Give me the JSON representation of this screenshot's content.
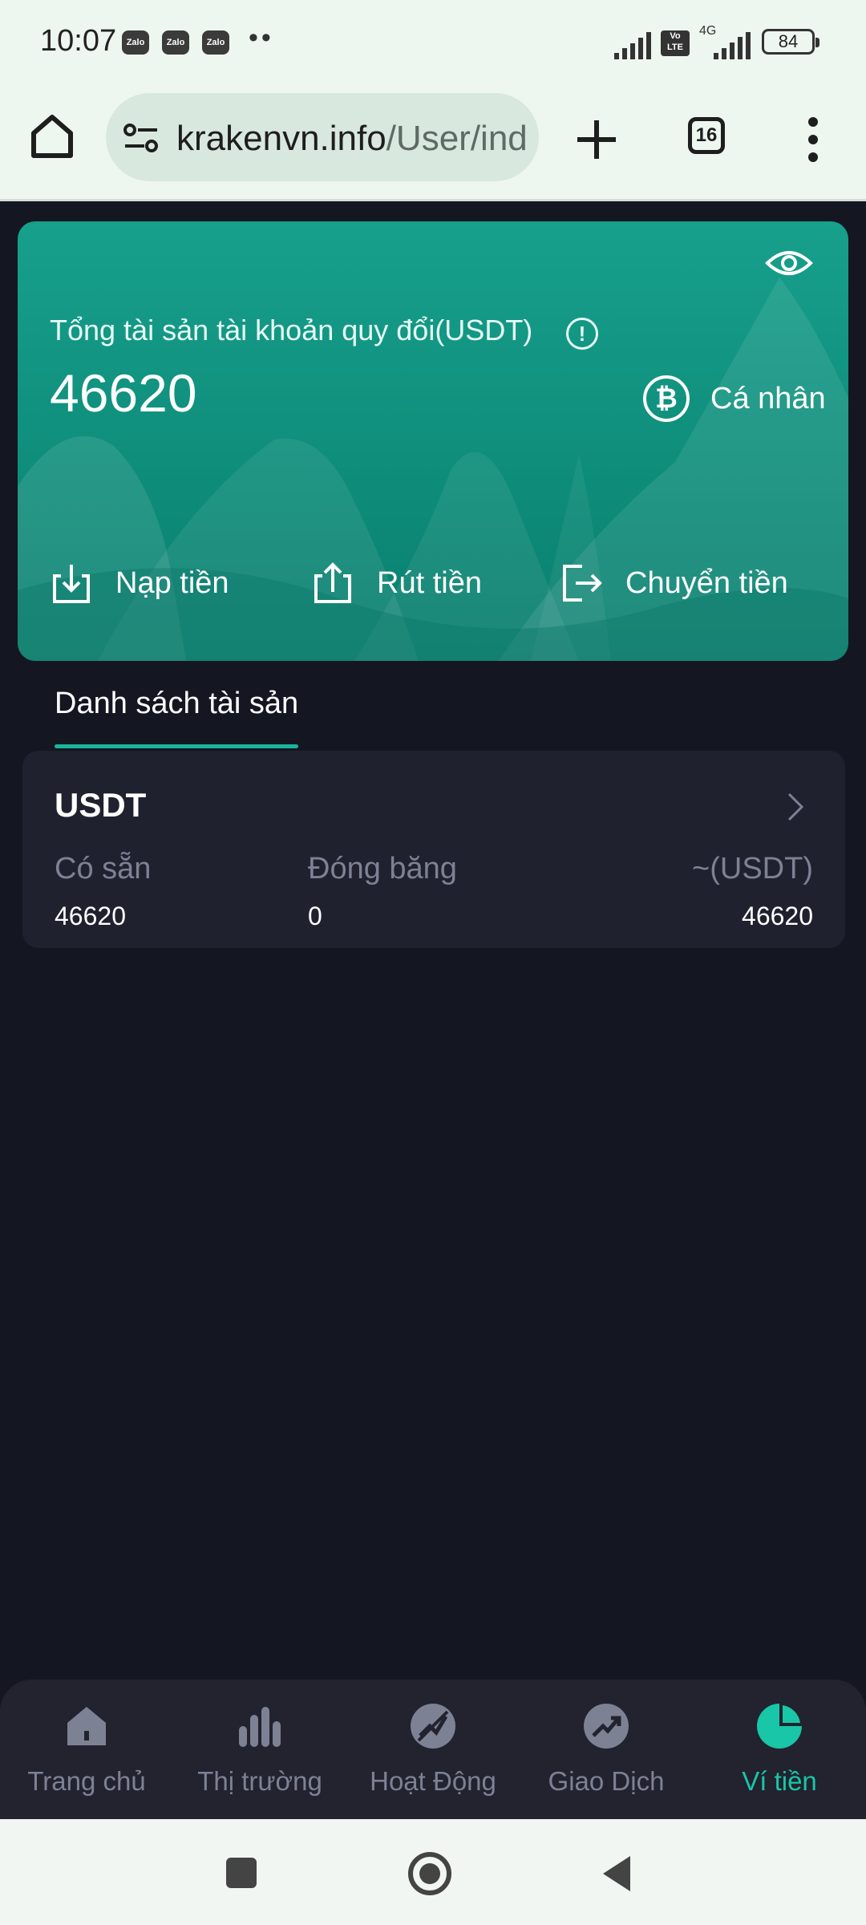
{
  "status_bar": {
    "time": "10:07",
    "notification_icons": [
      "Zalo",
      "Zalo",
      "Zalo"
    ],
    "more_dots": "••",
    "volte_label": "Vo LTE",
    "network_label": "4G",
    "battery": "84"
  },
  "browser": {
    "url_host": "krakenvn.info",
    "url_path": "/User/ind",
    "tab_count": "16"
  },
  "balance_card": {
    "label": "Tổng tài sản tài khoản quy đổi(USDT)",
    "amount": "46620",
    "account_type": "Cá nhân",
    "actions": [
      {
        "label": "Nạp tiền",
        "icon": "deposit-icon"
      },
      {
        "label": "Rút tiền",
        "icon": "withdraw-icon"
      },
      {
        "label": "Chuyển tiền",
        "icon": "transfer-icon"
      }
    ]
  },
  "asset_list": {
    "tab_label": "Danh sách tài sản",
    "items": [
      {
        "name": "USDT",
        "available_label": "Có sẵn",
        "available_value": "46620",
        "frozen_label": "Đóng băng",
        "frozen_value": "0",
        "converted_label": "~(USDT)",
        "converted_value": "46620"
      }
    ]
  },
  "bottom_nav": {
    "items": [
      {
        "label": "Trang chủ",
        "icon": "home-icon",
        "active": false
      },
      {
        "label": "Thị trường",
        "icon": "market-bars-icon",
        "active": false
      },
      {
        "label": "Hoạt Động",
        "icon": "activity-icon",
        "active": false
      },
      {
        "label": "Giao Dịch",
        "icon": "trade-trend-icon",
        "active": false
      },
      {
        "label": "Ví tiền",
        "icon": "wallet-pie-icon",
        "active": true
      }
    ]
  },
  "colors": {
    "accent": "#19c6a7",
    "card_top": "#17a08c",
    "card_bottom": "#0a7e6e",
    "page_bg": "#141621",
    "asset_card_bg": "#1f212e",
    "muted_text": "#7d8194"
  }
}
